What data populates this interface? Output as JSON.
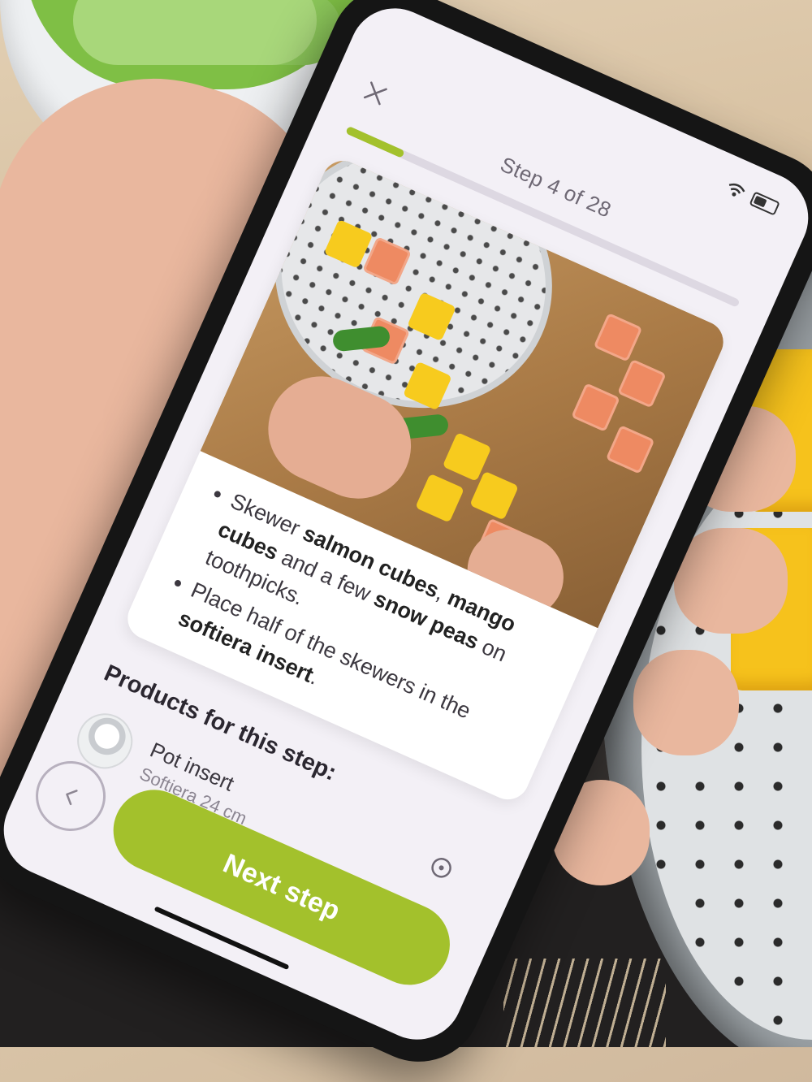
{
  "app": {
    "step_label": "Step 4 of 28",
    "progress": 0.143,
    "accent_color": "#a3c12c",
    "icons": {
      "close": "close-icon",
      "wifi": "wifi-icon",
      "battery": "battery-icon",
      "back": "chevron-left-icon",
      "zoom": "zoom-icon"
    }
  },
  "card": {
    "image_alt": "",
    "instructions": [
      {
        "parts": [
          {
            "text": "Skewer ",
            "bold": false
          },
          {
            "text": "salmon cubes",
            "bold": true
          },
          {
            "text": ", ",
            "bold": false
          },
          {
            "text": "mango cubes",
            "bold": true
          },
          {
            "text": " and a few ",
            "bold": false
          },
          {
            "text": "snow peas",
            "bold": true
          },
          {
            "text": " on toothpicks.",
            "bold": false
          }
        ]
      },
      {
        "parts": [
          {
            "text": "Place half of the skewers in the ",
            "bold": false
          },
          {
            "text": "softiera insert",
            "bold": true
          },
          {
            "text": ".",
            "bold": false
          }
        ]
      }
    ]
  },
  "products": {
    "title": "Products for this step:",
    "items": [
      {
        "name": "Pot insert",
        "subtitle": "Softiera 24 cm"
      }
    ]
  },
  "footer": {
    "next_label": "Next step"
  }
}
